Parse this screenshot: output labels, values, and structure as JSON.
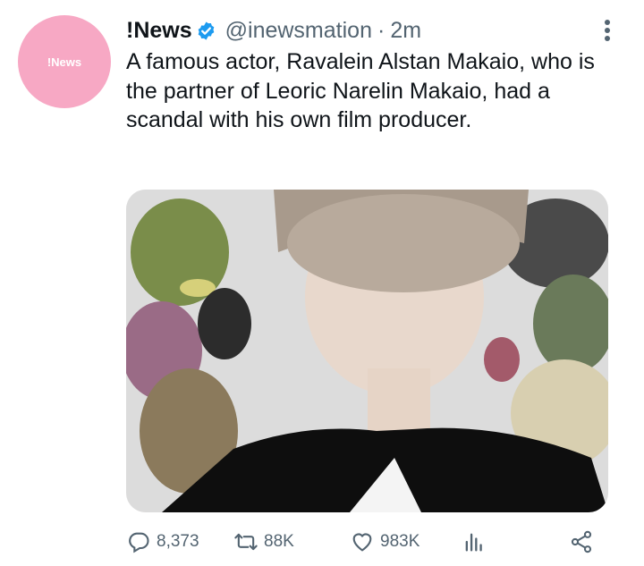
{
  "avatar": {
    "label": "!News"
  },
  "tweet": {
    "display_name": "!News",
    "handle": "@inewsmation",
    "separator": "·",
    "time": "2m",
    "text": "A famous actor, Ravalein Alstan Makaio, who is the partner of Leoric Narelin Makaio, had a scandal with his own film producer."
  },
  "media": {
    "description": "photo"
  },
  "actions": {
    "replies": "8,373",
    "retweets": "88K",
    "likes": "983K"
  },
  "icons": [
    "verified-icon",
    "more-icon",
    "reply-icon",
    "retweet-icon",
    "like-icon",
    "analytics-icon",
    "share-icon"
  ],
  "colors": {
    "verified": "#1d9bf0",
    "muted": "#536471",
    "avatar_bg": "#f7a8c4"
  }
}
